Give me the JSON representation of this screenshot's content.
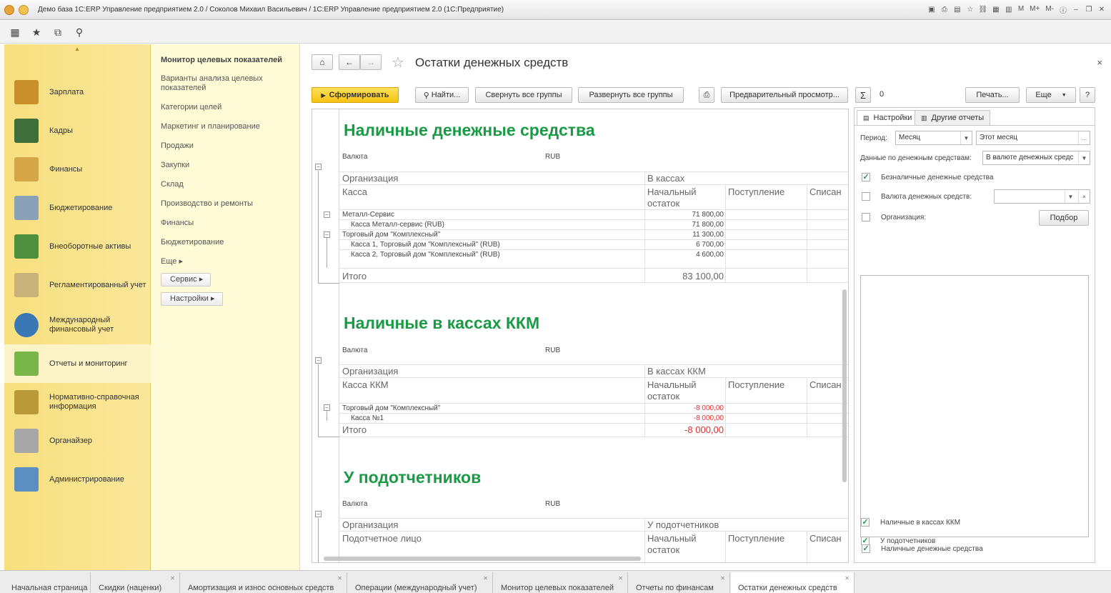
{
  "window": {
    "title": "Демо база 1С:ERP Управление предприятием 2.0 / Соколов Михаил Васильевич / 1С:ERP Управление предприятием 2.0  (1С:Предприятие)",
    "mem_labels": [
      "M",
      "M+",
      "M-"
    ]
  },
  "sections": {
    "items": [
      {
        "label": "Зарплата",
        "color": "#c98f2b"
      },
      {
        "label": "Кадры",
        "color": "#3e6e3a"
      },
      {
        "label": "Финансы",
        "color": "#d4a648"
      },
      {
        "label": "Бюджетирование",
        "color": "#8aa2b8"
      },
      {
        "label": "Внеоборотные активы",
        "color": "#4e8f3e"
      },
      {
        "label": "Регламентированный учет",
        "color": "#c9b27a"
      },
      {
        "label": "Международный финансовый учет",
        "color": "#3a77b5"
      },
      {
        "label": "Отчеты и мониторинг",
        "color": "#7ab54a"
      },
      {
        "label": "Нормативно-справочная информация",
        "color": "#b99a3a"
      },
      {
        "label": "Органайзер",
        "color": "#a8a8a8"
      },
      {
        "label": "Администрирование",
        "color": "#5b8fc2"
      }
    ]
  },
  "functions": {
    "header": "Монитор целевых показателей",
    "items": [
      "Варианты анализа целевых показателей",
      "Категории целей",
      "Маркетинг и планирование",
      "Продажи",
      "Закупки",
      "Склад",
      "Производство и ремонты",
      "Финансы",
      "Бюджетирование",
      "Еще ▸"
    ],
    "service_label": "Сервис",
    "settings_label": "Настройки"
  },
  "form": {
    "title": "Остатки денежных средств",
    "buttons": {
      "generate": "Сформировать",
      "find": "Найти...",
      "collapse": "Свернуть все группы",
      "expand": "Развернуть все группы",
      "preview": "Предварительный просмотр...",
      "sum_value": "0",
      "print": "Печать...",
      "more": "Еще",
      "help": "?"
    }
  },
  "report": {
    "sections": [
      {
        "title": "Наличные денежные средства",
        "currency_label": "Валюта",
        "currency_value": "RUB",
        "org_header": "Организация",
        "group_header": "В кассах",
        "col1_header": "Касса",
        "col_start": "Начальный остаток",
        "col_in": "Поступление",
        "col_out": "Списан",
        "rows": [
          {
            "name": "Металл-Сервис",
            "value": "71 800,00"
          },
          {
            "name": "Касса Металл-сервис (RUB)",
            "value": "71 800,00"
          },
          {
            "name": "Торговый дом \"Комплексный\"",
            "value": "11 300,00"
          },
          {
            "name": "Касса 1, Торговый дом \"Комплексный\" (RUB)",
            "value": "6 700,00"
          },
          {
            "name": "Касса 2, Торговый дом \"Комплексный\" (RUB)",
            "value": "4 600,00"
          }
        ],
        "total_label": "Итого",
        "total_value": "83 100,00"
      },
      {
        "title": "Наличные в кассах ККМ",
        "currency_label": "Валюта",
        "currency_value": "RUB",
        "org_header": "Организация",
        "group_header": "В кассах ККМ",
        "col1_header": "Касса ККМ",
        "col_start": "Начальный остаток",
        "col_in": "Поступление",
        "col_out": "Списан",
        "rows": [
          {
            "name": "Торговый дом \"Комплексный\"",
            "value": "-8 000,00"
          },
          {
            "name": "Касса №1",
            "value": "-8 000,00"
          }
        ],
        "total_label": "Итого",
        "total_value": "-8 000,00"
      },
      {
        "title": "У подотчетников",
        "currency_label": "Валюта",
        "currency_value": "RUB",
        "org_header": "Организация",
        "group_header": "У подотчетников",
        "col1_header": "Подотчетное лицо",
        "col_start": "Начальный остаток",
        "col_in": "Поступление",
        "col_out": "Списан"
      }
    ]
  },
  "settings": {
    "tab_settings": "Настройки",
    "tab_other": "Другие отчеты",
    "period_label": "Период:",
    "period_value": "Месяц",
    "period_range": "Этот месяц",
    "data_label": "Данные по денежным средствам:",
    "data_value": "В валюте денежных средс",
    "cashless_label": "Безналичные денежные средства",
    "cashless_checked": true,
    "currency_label": "Валюта денежных средств:",
    "currency_checked": false,
    "org_label": "Организация:",
    "org_checked": false,
    "select_button": "Подбор",
    "bottom_checks": [
      {
        "label": "Наличные денежные средства",
        "checked": true
      },
      {
        "label": "Наличные в кассах ККМ",
        "checked": true
      },
      {
        "label": "У подотчетников",
        "checked": true
      }
    ]
  },
  "bottom_tabs": [
    {
      "label": "Начальная страница"
    },
    {
      "label": "Скидки (наценки)"
    },
    {
      "label": "Амортизация и износ основных средств"
    },
    {
      "label": "Операции (международный учет)"
    },
    {
      "label": "Монитор целевых показателей"
    },
    {
      "label": "Отчеты по финансам"
    },
    {
      "label": "Остатки денежных средств"
    }
  ]
}
